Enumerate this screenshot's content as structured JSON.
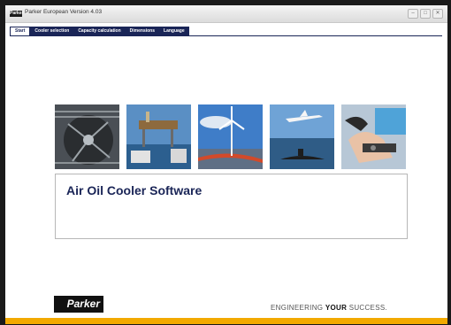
{
  "window": {
    "title": "Parker European Version 4.03",
    "app_icon_text": "Parker"
  },
  "controls": {
    "minimize": "–",
    "maximize": "□",
    "close": "✕"
  },
  "tabs": [
    {
      "label": "Start",
      "active": true
    },
    {
      "label": "Cooler selection",
      "active": false
    },
    {
      "label": "Capacity calculation",
      "active": false
    },
    {
      "label": "Dimensions",
      "active": false
    },
    {
      "label": "Language",
      "active": false
    }
  ],
  "photos": [
    "industrial-cooler-fan",
    "offshore-oil-rig",
    "wind-turbine",
    "airplane-and-submarine",
    "hand-operating-controls"
  ],
  "main": {
    "heading": "Air Oil Cooler Software"
  },
  "footer": {
    "logo": "Parker",
    "slogan_start": "ENGINEERING ",
    "slogan_bold": "YOUR",
    "slogan_end": " SUCCESS."
  },
  "colors": {
    "brand_navy": "#1a2557",
    "brand_yellow": "#f2a900"
  }
}
